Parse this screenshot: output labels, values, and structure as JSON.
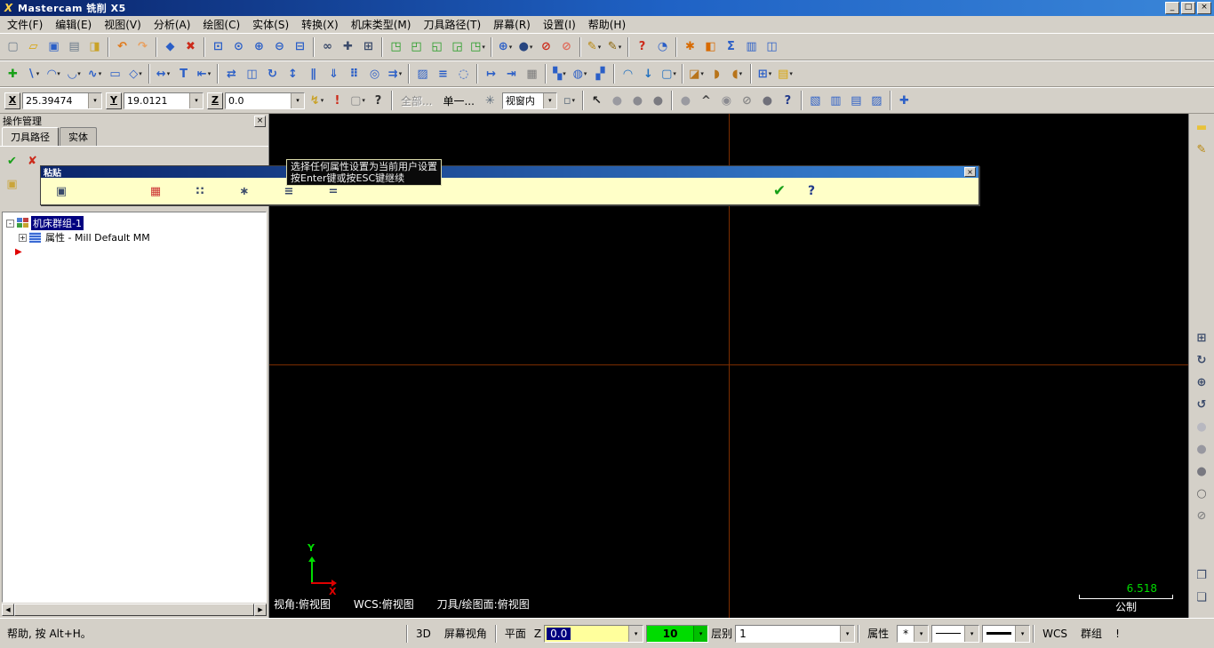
{
  "window": {
    "title": "Mastercam 铣削 X5",
    "app_icon": "X",
    "minimize_glyph": "_",
    "maximize_glyph": "□",
    "close_glyph": "×"
  },
  "menu": [
    {
      "name": "menu-file",
      "label": "文件(F)"
    },
    {
      "name": "menu-edit",
      "label": "编辑(E)"
    },
    {
      "name": "menu-view",
      "label": "视图(V)"
    },
    {
      "name": "menu-analyze",
      "label": "分析(A)"
    },
    {
      "name": "menu-create",
      "label": "绘图(C)"
    },
    {
      "name": "menu-solids",
      "label": "实体(S)"
    },
    {
      "name": "menu-xform",
      "label": "转换(X)"
    },
    {
      "name": "menu-machine-type",
      "label": "机床类型(M)"
    },
    {
      "name": "menu-toolpaths",
      "label": "刀具路径(T)"
    },
    {
      "name": "menu-screen",
      "label": "屏幕(R)"
    },
    {
      "name": "menu-settings",
      "label": "设置(I)"
    },
    {
      "name": "menu-help",
      "label": "帮助(H)"
    }
  ],
  "ui": {
    "dropdown_glyph": "▾",
    "scroll_left_glyph": "◀",
    "scroll_right_glyph": "▶"
  },
  "toolbars": {
    "row1": [
      {
        "name": "new-file",
        "g": "▢",
        "c": "#6a7a8a"
      },
      {
        "name": "open-file",
        "g": "▱",
        "c": "#d8a200"
      },
      {
        "name": "save-file",
        "g": "▣",
        "c": "#2b5fc7"
      },
      {
        "name": "print",
        "g": "▤",
        "c": "#6a7a8a"
      },
      {
        "name": "print-preview",
        "g": "◨",
        "c": "#c9a227"
      },
      {
        "sep": true
      },
      {
        "name": "undo",
        "g": "↶",
        "c": "#e07818"
      },
      {
        "name": "redo",
        "g": "↷",
        "c": "#e8a060"
      },
      {
        "sep": true
      },
      {
        "name": "repaint",
        "g": "◆",
        "c": "#2b5fc7"
      },
      {
        "name": "delete-entities",
        "g": "✖",
        "c": "#cc2a1a"
      },
      {
        "sep": true
      },
      {
        "name": "zoom-window",
        "g": "⊡",
        "c": "#2b5fc7"
      },
      {
        "name": "zoom-target",
        "g": "⊙",
        "c": "#2b5fc7"
      },
      {
        "name": "zoom-in",
        "g": "⊕",
        "c": "#2b5fc7"
      },
      {
        "name": "zoom-out",
        "g": "⊖",
        "c": "#2b5fc7"
      },
      {
        "name": "unzoom",
        "g": "⊟",
        "c": "#2b5fc7"
      },
      {
        "sep": true
      },
      {
        "name": "dynamic-rotate",
        "g": "∞",
        "c": "#3a4a6a"
      },
      {
        "name": "pan",
        "g": "✚",
        "c": "#3a4a6a"
      },
      {
        "name": "fit-screen",
        "g": "⊞",
        "c": "#3a4a6a"
      },
      {
        "sep": true
      },
      {
        "name": "view-isometric",
        "g": "◳",
        "c": "#1f9a1f"
      },
      {
        "name": "view-top",
        "g": "◰",
        "c": "#1f9a1f"
      },
      {
        "name": "view-front",
        "g": "◱",
        "c": "#1f9a1f"
      },
      {
        "name": "view-side",
        "g": "◲",
        "c": "#1f9a1f"
      },
      {
        "name": "view-list",
        "g": "◳",
        "c": "#1f9a1f",
        "dd": true
      },
      {
        "sep": true
      },
      {
        "name": "wcs-planes",
        "g": "⊕",
        "c": "#2b5fc7",
        "dd": true
      },
      {
        "name": "construction-planes",
        "g": "●",
        "c": "#27457f",
        "dd": true
      },
      {
        "name": "blank-entity",
        "g": "⊘",
        "c": "#cc2a1a"
      },
      {
        "name": "unblank-entity",
        "g": "⊘",
        "c": "#e06a5a"
      },
      {
        "sep": true
      },
      {
        "name": "entity-attributes-pencil",
        "g": "✎",
        "c": "#b8860b",
        "dd": true
      },
      {
        "name": "set-attributes-pencil",
        "g": "✎",
        "c": "#8a6508",
        "dd": true
      },
      {
        "sep": true
      },
      {
        "name": "help",
        "g": "?",
        "c": "#cc2a1a"
      },
      {
        "name": "analyze-position",
        "g": "◔",
        "c": "#2b5fc7"
      },
      {
        "sep": true
      },
      {
        "name": "run-chook",
        "g": "✱",
        "c": "#d86a00"
      },
      {
        "name": "ram-saver",
        "g": "◧",
        "c": "#d86a00"
      },
      {
        "name": "tolerance-sigma",
        "g": "Σ",
        "c": "#2b5fc7"
      },
      {
        "name": "code-expert",
        "g": "▥",
        "c": "#2b5fc7"
      },
      {
        "name": "mastercam-home",
        "g": "◫",
        "c": "#2b5fc7"
      }
    ],
    "row2": [
      {
        "name": "create-point",
        "g": "✚",
        "c": "#18a018"
      },
      {
        "name": "create-line",
        "g": "∖",
        "c": "#2b5fc7",
        "dd": true
      },
      {
        "name": "create-arc",
        "g": "◠",
        "c": "#2b5fc7",
        "dd": true
      },
      {
        "name": "create-fillet",
        "g": "◡",
        "c": "#2b5fc7",
        "dd": true
      },
      {
        "name": "create-spline",
        "g": "∿",
        "c": "#2b5fc7",
        "dd": true
      },
      {
        "name": "create-rectangle",
        "g": "▭",
        "c": "#2b5fc7"
      },
      {
        "name": "create-polygon",
        "g": "◇",
        "c": "#2b5fc7",
        "dd": true
      },
      {
        "sep": true
      },
      {
        "name": "dimension-smart",
        "g": "↔",
        "c": "#2b5fc7",
        "dd": true
      },
      {
        "name": "dimension-note",
        "g": "T",
        "c": "#2b5fc7"
      },
      {
        "name": "dimension-options",
        "g": "⇤",
        "c": "#2b5fc7",
        "dd": true
      },
      {
        "sep": true
      },
      {
        "name": "xform-translate",
        "g": "⇄",
        "c": "#2b5fc7"
      },
      {
        "name": "xform-mirror",
        "g": "◫",
        "c": "#2b5fc7"
      },
      {
        "name": "xform-rotate",
        "g": "↻",
        "c": "#2b5fc7"
      },
      {
        "name": "xform-scale",
        "g": "↕",
        "c": "#2b5fc7"
      },
      {
        "name": "xform-offset",
        "g": "∥",
        "c": "#2b5fc7"
      },
      {
        "name": "xform-project",
        "g": "⇓",
        "c": "#2b5fc7"
      },
      {
        "name": "xform-rectangular-array",
        "g": "⠿",
        "c": "#2b5fc7"
      },
      {
        "name": "xform-wrap",
        "g": "◎",
        "c": "#2b5fc7"
      },
      {
        "name": "xform-stretch",
        "g": "⇉",
        "c": "#2b5fc7",
        "dd": true
      },
      {
        "sep": true
      },
      {
        "name": "screen-clear-colors",
        "g": "▨",
        "c": "#2b5fc7"
      },
      {
        "name": "screen-statistics",
        "g": "≡",
        "c": "#2b5fc7"
      },
      {
        "name": "screen-blank-entities",
        "g": "◌",
        "c": "#2b5fc7"
      },
      {
        "sep": true
      },
      {
        "name": "analyze-distance",
        "g": "↦",
        "c": "#2b5fc7"
      },
      {
        "name": "analyze-dynamic",
        "g": "⇥",
        "c": "#2b5fc7"
      },
      {
        "name": "hatch",
        "g": "▦",
        "c": "#7a7a7a"
      },
      {
        "sep": true
      },
      {
        "name": "machine-mill",
        "g": "▚",
        "c": "#2b5fc7",
        "dd": true
      },
      {
        "name": "machine-lathe",
        "g": "◍",
        "c": "#2b5fc7",
        "dd": true
      },
      {
        "name": "machine-control-def",
        "g": "▞",
        "c": "#2b5fc7"
      },
      {
        "sep": true
      },
      {
        "name": "toolpath-contour",
        "g": "◠",
        "c": "#1f6fbf"
      },
      {
        "name": "toolpath-drill",
        "g": "↓",
        "c": "#1f6fbf"
      },
      {
        "name": "toolpath-pocket",
        "g": "▢",
        "c": "#1f6fbf",
        "dd": true
      },
      {
        "sep": true
      },
      {
        "name": "solid-extrude",
        "g": "◪",
        "c": "#b8741a",
        "dd": true
      },
      {
        "name": "solid-revolve",
        "g": "◗",
        "c": "#b8741a"
      },
      {
        "name": "solid-fillet",
        "g": "◖",
        "c": "#b8741a",
        "dd": true
      },
      {
        "sep": true
      },
      {
        "name": "grid-settings",
        "g": "⊞",
        "c": "#2b5fc7",
        "dd": true
      },
      {
        "name": "recent-functions",
        "g": "▤",
        "c": "#d8a200",
        "dd": true
      }
    ],
    "coord_trailing": [
      {
        "name": "fastpoint",
        "g": "↯",
        "c": "#c9a227",
        "dd": true
      },
      {
        "name": "autocursor-alert",
        "g": "!",
        "c": "#cc2a1a"
      },
      {
        "name": "point-style",
        "g": "▢",
        "c": "#8a8a8a",
        "dd": true
      },
      {
        "name": "autocursor-help",
        "g": "?",
        "c": "#333333"
      }
    ],
    "selection_trailing": [
      {
        "name": "selection-box-mode",
        "g": "▫",
        "c": "#5a6a7a",
        "dd": true
      },
      {
        "sep": true
      },
      {
        "name": "select-arrow",
        "g": "↖",
        "c": "#222222"
      },
      {
        "name": "quick-mask-result",
        "g": "●",
        "c": "#9a9aa0"
      },
      {
        "name": "quick-mask-group",
        "g": "●",
        "c": "#8a8a90"
      },
      {
        "name": "quick-mask-last",
        "g": "●",
        "c": "#7a7a80"
      },
      {
        "sep": true
      },
      {
        "name": "quick-mask-points",
        "g": "●",
        "c": "#9a9aa0"
      },
      {
        "name": "quick-mask-invert",
        "g": "^",
        "c": "#444444"
      },
      {
        "name": "quick-mask-lines",
        "g": "◉",
        "c": "#8a8a90"
      },
      {
        "name": "quick-mask-clear",
        "g": "⊘",
        "c": "#888888"
      },
      {
        "name": "quick-mask-solids",
        "g": "●",
        "c": "#70707a"
      },
      {
        "name": "quick-mask-help",
        "g": "?",
        "c": "#223a8a"
      },
      {
        "sep": true
      },
      {
        "name": "clear-colors",
        "g": "▧",
        "c": "#2b5fc7"
      },
      {
        "name": "copy-attributes",
        "g": "▥",
        "c": "#2b5fc7"
      },
      {
        "name": "set-z-depth",
        "g": "▤",
        "c": "#2b5fc7"
      },
      {
        "name": "set-attributes-from",
        "g": "▨",
        "c": "#2b5fc7"
      },
      {
        "sep": true
      },
      {
        "name": "gview-select",
        "g": "✚",
        "c": "#2b5fc7"
      }
    ],
    "right": [
      {
        "name": "mru-sticky-note",
        "g": "▬",
        "c": "#e8c23a"
      },
      {
        "name": "mru-pencil",
        "g": "✎",
        "c": "#b8860b"
      },
      {
        "spacer": 185
      },
      {
        "name": "right-fit-screen",
        "g": "⊞",
        "c": "#3a4a6a"
      },
      {
        "name": "right-repaint",
        "g": "↻",
        "c": "#3a4a6a"
      },
      {
        "name": "right-zoom",
        "g": "⊕",
        "c": "#3a4a6a"
      },
      {
        "name": "right-rotate",
        "g": "↺",
        "c": "#3a4a6a"
      },
      {
        "name": "shade-sphere-light",
        "g": "●",
        "c": "#b8b8c0"
      },
      {
        "name": "shade-sphere-mid",
        "g": "●",
        "c": "#9898a0"
      },
      {
        "name": "shade-sphere-dark",
        "g": "●",
        "c": "#787880"
      },
      {
        "name": "wireframe-toggle",
        "g": "○",
        "c": "#666666"
      },
      {
        "name": "right-blank",
        "g": "⊘",
        "c": "#888888"
      },
      {
        "spacer": 40
      },
      {
        "name": "right-page-copy",
        "g": "❐",
        "c": "#3a4a6a"
      },
      {
        "name": "right-page-new",
        "g": "❏",
        "c": "#3a4a6a"
      }
    ]
  },
  "coordbar": {
    "x_label": "X",
    "x_value": "25.39474",
    "y_label": "Y",
    "y_value": "19.0121",
    "z_label": "Z",
    "z_value": "0.0",
    "all_label": "全部...",
    "single_label": "单一...",
    "settings_glyph": "✳",
    "window_combo_value": "视窗内"
  },
  "panel": {
    "title": "操作管理",
    "close_glyph": "×",
    "tabs": [
      "刀具路径",
      "实体"
    ],
    "toolbar_row1": [
      {
        "name": "select-all-operations",
        "g": "✔",
        "c": "#18a018"
      },
      {
        "name": "unselect-all-operations",
        "g": "✘",
        "c": "#cc2a1a"
      }
    ],
    "toolbar_row2": [
      {
        "name": "lock",
        "g": "▣",
        "c": "#caa53a"
      }
    ],
    "tree": [
      {
        "exp": "-",
        "icon": "machine-group-icon",
        "label": "机床群组-1",
        "selected": true
      },
      {
        "exp": "+",
        "icon": "properties-icon",
        "label": "属性 - Mill Default MM",
        "indent": 1
      },
      {
        "insertion_arrow": true,
        "arrow_glyph": "▶"
      }
    ]
  },
  "paste_dialog": {
    "title": "粘贴",
    "close_glyph": "×",
    "ok_glyph": "✔",
    "help_glyph": "?",
    "buttons": [
      {
        "name": "paste-attribute",
        "g": "▣",
        "c": "#3a4a6a",
        "ml": 2
      },
      {
        "name": "attribute-color",
        "g": "▦",
        "c": "#cc3333",
        "ml": 72
      },
      {
        "name": "attribute-point-style",
        "g": "∷",
        "c": "#3a4a6a",
        "ml": 16
      },
      {
        "name": "attribute-line-style",
        "g": "∗",
        "c": "#3a4a6a",
        "ml": 16
      },
      {
        "name": "attribute-level",
        "g": "≡",
        "c": "#3a4a6a",
        "ml": 16
      },
      {
        "name": "attribute-line-width",
        "g": "=",
        "c": "#3a4a6a",
        "ml": 16
      }
    ],
    "tooltip": [
      "选择任何属性设置为当前用户设置",
      "按Enter键或按ESC键继续"
    ]
  },
  "viewport": {
    "gview": "视角:俯视图",
    "wcs": "WCS:俯视图",
    "cplane": "刀具/绘图面:俯视图",
    "scale_value": "6.518",
    "scale_unit": "公制",
    "axis_x": "X",
    "axis_y": "Y"
  },
  "statusbar": {
    "help_text": "帮助, 按 Alt+H。",
    "mode_3d": "3D",
    "screen_view": "屏幕视角",
    "plane": "平面",
    "z_label": "Z",
    "z_value": "0.0",
    "color_value": "10",
    "level_label": "层别",
    "level_value": "1",
    "attributes": "属性",
    "star": "*",
    "wcs": "WCS",
    "group": "群组",
    "exclaim": "!"
  },
  "colors": {
    "titlebar_start": "#0a246a",
    "titlebar_end": "#3a86d8",
    "chrome": "#d4d0c8",
    "viewport_bg": "#000000",
    "crosshair": "#7b2d00",
    "selection_bg": "#000080",
    "ribbon_bg": "#ffffc8",
    "z_field_bg": "#ffff9c",
    "color_field_bg": "#00dc00",
    "axis_x": "#e00000",
    "axis_y": "#00dc00",
    "scale_text": "#00dc00"
  }
}
